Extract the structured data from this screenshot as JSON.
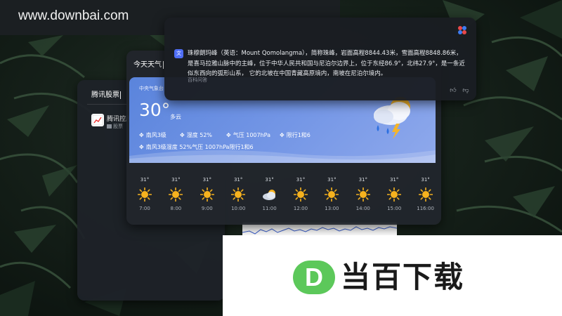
{
  "watermark": {
    "text": "www.downbai.com"
  },
  "stock_panel": {
    "query": "腾讯股票",
    "item": {
      "name": "腾讯控股",
      "subtitle": "股票"
    }
  },
  "weather_panel": {
    "query": "今天天气",
    "station": "中央气象台",
    "temperature": "30°",
    "condition": "多云",
    "stats": [
      {
        "icon": "wind-icon",
        "text": "南风3级"
      },
      {
        "icon": "humidity-icon",
        "text": "湿度 52%"
      },
      {
        "icon": "pressure-icon",
        "text": "气压 1007hPa"
      },
      {
        "icon": "restriction-icon",
        "text": "限行1和6"
      }
    ],
    "summary": "南风3级湿度 52%气压 1007hPa限行1和6",
    "hourly": [
      {
        "temp": "31°",
        "icon": "sun-icon",
        "time": "7:00"
      },
      {
        "temp": "31°",
        "icon": "sun-icon",
        "time": "8:00"
      },
      {
        "temp": "31°",
        "icon": "sun-icon",
        "time": "9:00"
      },
      {
        "temp": "31°",
        "icon": "sun-icon",
        "time": "10:00"
      },
      {
        "temp": "31°",
        "icon": "cloud-sun-icon",
        "time": "11:00"
      },
      {
        "temp": "31°",
        "icon": "sun-icon",
        "time": "12:00"
      },
      {
        "temp": "31°",
        "icon": "sun-icon",
        "time": "13:00"
      },
      {
        "temp": "31°",
        "icon": "sun-icon",
        "time": "14:00"
      },
      {
        "temp": "31°",
        "icon": "sun-icon",
        "time": "15:00"
      },
      {
        "temp": "31°",
        "icon": "sun-icon",
        "time": "116:00"
      }
    ]
  },
  "info_panel": {
    "text": "珠穆朗玛峰（英语：Mount Qomolangma），简称珠峰，岩面高程8844.43米，雪面高程8848.86米，是喜马拉雅山脉中的主峰，位于中华人民共和国与尼泊尔边界上，位于东经86.9°，北纬27.9°，是一条近似东西向的弧形山系， 它的北坡在中国青藏高原境内，南坡在尼泊尔境内。",
    "source": "百科问答",
    "ai_badge": "文",
    "like_icon": "thumbs-up-icon",
    "dislike_icon": "thumbs-down-icon"
  },
  "banner": {
    "logo_letter": "D",
    "text": "当百下载"
  },
  "colors": {
    "weather_card": "#6b8fe2",
    "sun": "#f6b21e",
    "banner_logo_green": "#5cc85a",
    "panel_bg": "#21252c"
  }
}
